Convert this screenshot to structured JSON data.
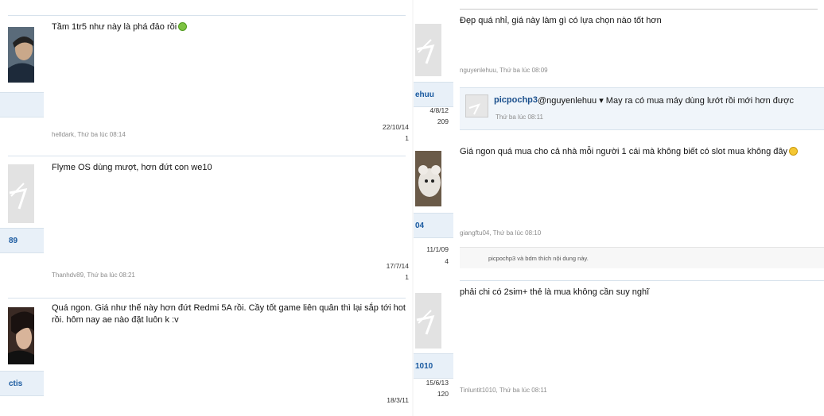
{
  "left_posts": [
    {
      "avatar": "photo-avatar-dark",
      "username": "",
      "join_date": "22/10/14",
      "messages": "1",
      "message": "Tầm 1tr5 như này là phá đảo rồi",
      "emoji": "green-smiley",
      "meta": "helldark, Thứ ba lúc 08:14"
    },
    {
      "avatar": "default-avatar",
      "username": "89",
      "join_date": "17/7/14",
      "messages": "1",
      "message": "Flyme OS dùng mượt, hơn đứt con we10",
      "emoji": "",
      "meta": "Thanhdv89, Thứ ba lúc 08:21"
    },
    {
      "avatar": "photo-avatar-noctis",
      "username": "ctis",
      "join_date": "18/3/11",
      "messages": "",
      "message": "Quá ngon. Giá như thế này hơn đứt Redmi 5A rồi. Cầy tốt game liên quân thì lại sắp tới hot rồi. hôm nay ae nào đặt luôn k :v",
      "emoji": "",
      "meta": ""
    }
  ],
  "right_posts": [
    {
      "avatar": "default-avatar",
      "username": "ehuu",
      "join_date": "4/8/12",
      "messages": "209",
      "message": "Đẹp quá nhỉ, giá này làm gì có lựa chọn nào tốt hơn",
      "meta": "nguyenlehuu, Thứ ba lúc 08:09",
      "reply": {
        "name": "picpochp3",
        "text": "@nguyenlehuu ▾ May ra có mua máy dùng lướt rồi mới hơn được",
        "meta": "Thứ ba lúc 08:11"
      }
    },
    {
      "avatar": "photo-avatar-bear",
      "username": "04",
      "join_date": "11/1/09",
      "messages": "4",
      "message": "Giá ngon quá mua cho cả nhà mỗi người 1 cái mà không biết có slot mua không đây",
      "emoji": "yellow-smiley",
      "meta": "giangftu04, Thứ ba lúc 08:10",
      "likes": "picpochp3 và bdm thích nội dung này."
    },
    {
      "avatar": "default-avatar",
      "username": "1010",
      "join_date": "15/6/13",
      "messages": "120",
      "message": "phải chi có 2sim+ thẻ là mua không cần suy nghĩ",
      "meta": "Tinluntit1010, Thứ ba lúc 08:11"
    }
  ],
  "colors": {
    "username": "#1a5aa0",
    "meta": "#8c8c8c",
    "separator": "#d7e2ec",
    "reply_bg": "#f0f5fa"
  }
}
